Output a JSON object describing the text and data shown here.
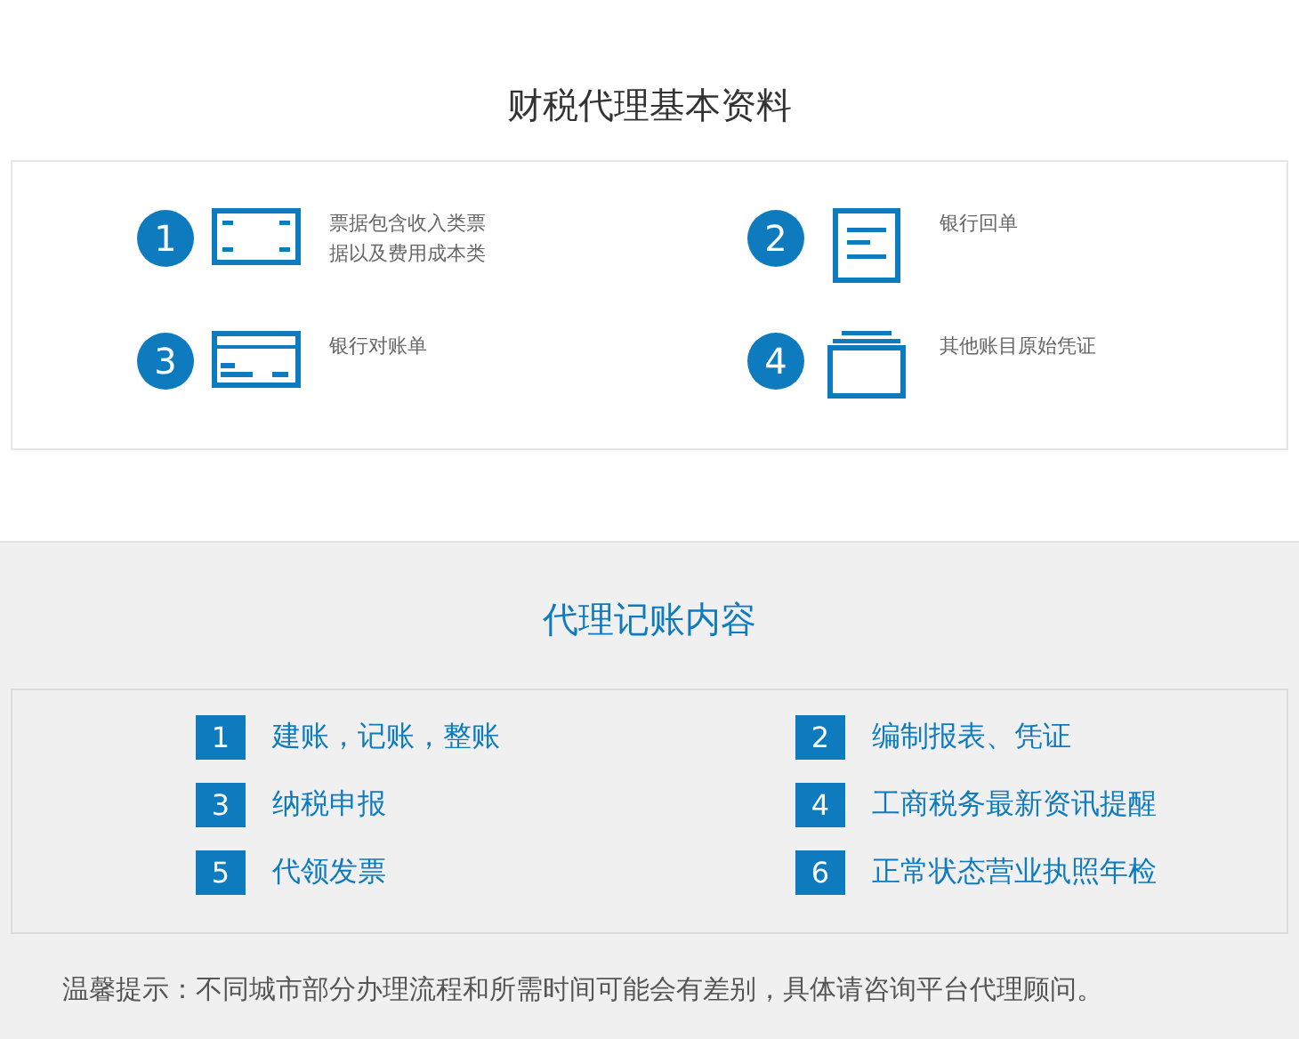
{
  "materials": {
    "title": "财税代理基本资料",
    "items": [
      {
        "number": "1",
        "text": "票据包含收入类票据以及费用成本类"
      },
      {
        "number": "2",
        "text": "银行回单"
      },
      {
        "number": "3",
        "text": "银行对账单"
      },
      {
        "number": "4",
        "text": "其他账目原始凭证"
      }
    ]
  },
  "services": {
    "title": "代理记账内容",
    "items": [
      {
        "number": "1",
        "text": "建账，记账，整账"
      },
      {
        "number": "2",
        "text": "编制报表、凭证"
      },
      {
        "number": "3",
        "text": "纳税申报"
      },
      {
        "number": "4",
        "text": "工商税务最新资讯提醒"
      },
      {
        "number": "5",
        "text": "代领发票"
      },
      {
        "number": "6",
        "text": "正常状态营业执照年检"
      }
    ]
  },
  "note": "温馨提示：不同城市部分办理流程和所需时间可能会有差别，具体请咨询平台代理顾问。"
}
